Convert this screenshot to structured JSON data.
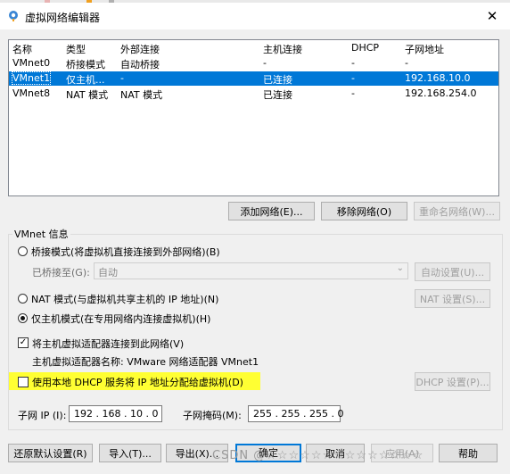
{
  "window": {
    "title": "虚拟网络编辑器",
    "close_glyph": "✕",
    "top_strip_colors": [
      "#e8b3b3",
      "#f0a020",
      "#b0b0b0"
    ]
  },
  "table": {
    "headers": [
      "名称",
      "类型",
      "外部连接",
      "主机连接",
      "DHCP",
      "子网地址"
    ],
    "rows": [
      {
        "name": "VMnet0",
        "type": "桥接模式",
        "external": "自动桥接",
        "host": "-",
        "dhcp": "-",
        "subnet": "-",
        "selected": false
      },
      {
        "name": "VMnet1",
        "type": "仅主机...",
        "external": "-",
        "host": "已连接",
        "dhcp": "-",
        "subnet": "192.168.10.0",
        "selected": true
      },
      {
        "name": "VMnet8",
        "type": "NAT 模式",
        "external": "NAT 模式",
        "host": "已连接",
        "dhcp": "-",
        "subnet": "192.168.254.0",
        "selected": false
      }
    ],
    "selection_color": "#0078d7"
  },
  "network_buttons": {
    "add": "添加网络(E)...",
    "remove": "移除网络(O)",
    "rename": "重命名网络(W)..."
  },
  "vmnet_info": {
    "group_label": "VMnet 信息",
    "bridge_radio": "桥接模式(将虚拟机直接连接到外部网络)(B)",
    "bridged_to_label": "已桥接至(G):",
    "bridged_to_value": "自动",
    "auto_settings": "自动设置(U)...",
    "nat_radio": "NAT 模式(与虚拟机共享主机的 IP 地址)(N)",
    "nat_settings": "NAT 设置(S)...",
    "host_only_radio": "仅主机模式(在专用网络内连接虚拟机)(H)",
    "selected_mode": "host_only",
    "connect_adapter_check": "将主机虚拟适配器连接到此网络(V)",
    "connect_adapter_checked": true,
    "adapter_name_text": "主机虚拟适配器名称: VMware 网络适配器 VMnet1",
    "dhcp_check": "使用本地 DHCP 服务将 IP 地址分配给虚拟机(D)",
    "dhcp_checked": false,
    "dhcp_settings": "DHCP 设置(P)...",
    "highlight_color": "#ffff33",
    "subnet_ip_label": "子网 IP (I):",
    "subnet_ip": "192 . 168 . 10 . 0",
    "subnet_mask_label": "子网掩码(M):",
    "subnet_mask": "255 . 255 . 255 . 0"
  },
  "footer": {
    "restore": "还原默认设置(R)",
    "import": "导入(T)...",
    "export": "导出(X)...",
    "ok": "确定",
    "cancel": "取消",
    "apply": "应用(A)",
    "help": "帮助"
  },
  "watermark": "CSDN @☆☆☆☆☆☆☆☆☆☆☆☆☆☆"
}
